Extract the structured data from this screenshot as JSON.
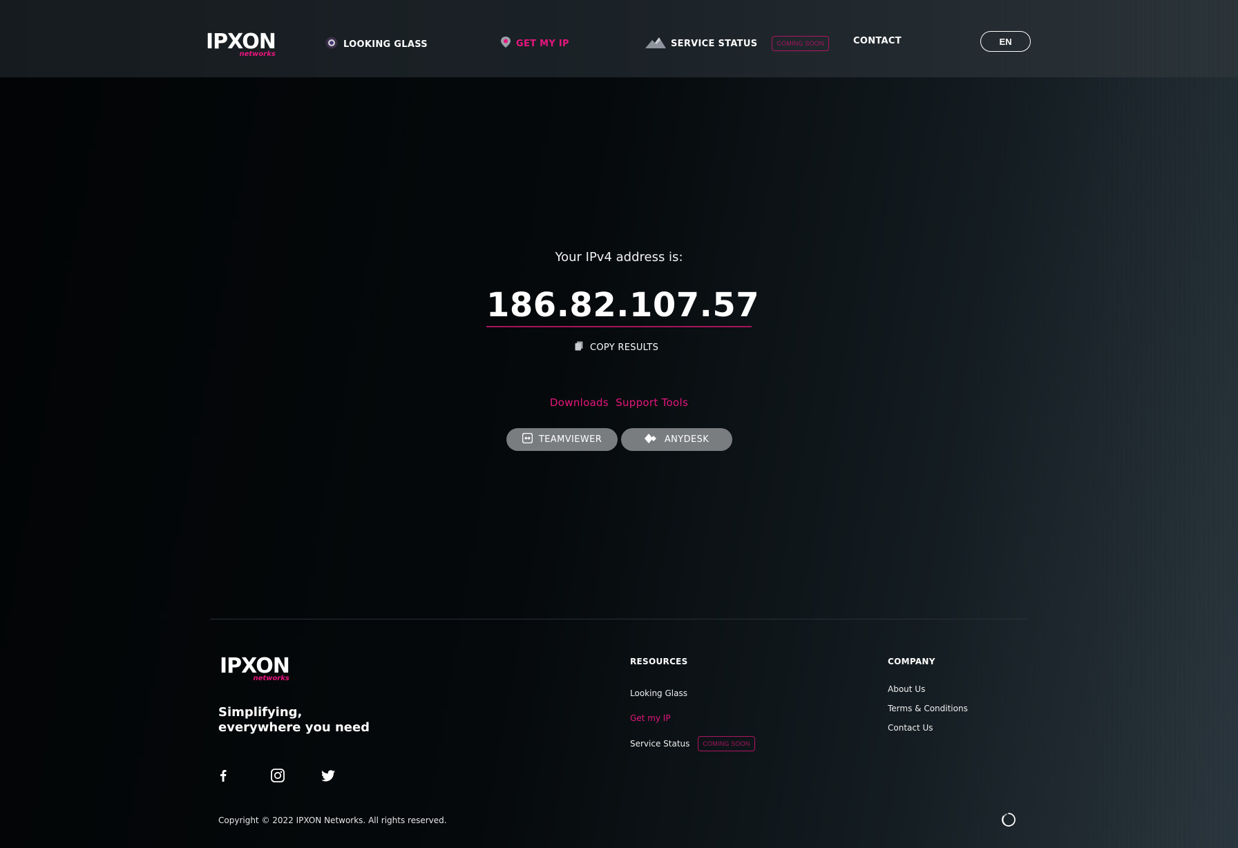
{
  "header": {
    "logo": {
      "word": "IPXON",
      "sub": "networks"
    },
    "nav": {
      "looking_glass": "LOOKING GLASS",
      "get_my_ip": "GET MY IP",
      "service_status": "SERVICE STATUS",
      "coming_soon": "COMING SOON",
      "contact": "CONTACT"
    },
    "language": "EN"
  },
  "hero": {
    "label": "Your IPv4 address is:",
    "ip": "186.82.107.57",
    "copy_label": "COPY RESULTS"
  },
  "tools": {
    "title_part1": "Downloads",
    "title_part2": "Support Tools",
    "teamviewer": "TEAMVIEWER",
    "anydesk": "ANYDESK"
  },
  "footer": {
    "logo": {
      "word": "IPXON",
      "sub": "networks"
    },
    "tagline_line1": "Simplifying,",
    "tagline_line2": "everywhere you need",
    "social": [
      "facebook-icon",
      "instagram-icon",
      "twitter-icon"
    ],
    "resources": {
      "title": "RESOURCES",
      "looking_glass": "Looking Glass",
      "get_my_ip": "Get my IP",
      "service_status": "Service Status",
      "coming_soon": "COMING SOON"
    },
    "company": {
      "title": "COMPANY",
      "about": "About Us",
      "terms": "Terms & Conditions",
      "contact": "Contact Us"
    },
    "copyright": "Copyright © 2022 IPXON Networks. All rights reserved."
  },
  "colors": {
    "accent": "#e6167e",
    "button_bg": "#7a7d80"
  }
}
